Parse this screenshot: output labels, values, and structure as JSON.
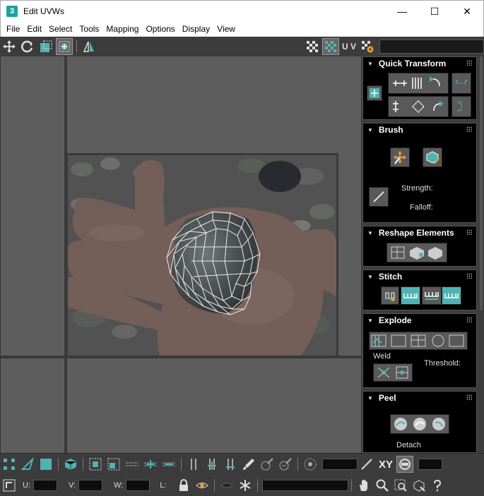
{
  "window": {
    "app_icon_text": "3",
    "title": "Edit UVWs",
    "minimize": "—",
    "maximize": "☐",
    "close": "✕"
  },
  "menu": [
    "File",
    "Edit",
    "Select",
    "Tools",
    "Mapping",
    "Options",
    "Display",
    "View"
  ],
  "top_toolbar": {
    "uv_label": "U V",
    "texture_dropdown_value": ""
  },
  "panel": {
    "quick_transform": {
      "title": "Quick Transform"
    },
    "brush": {
      "title": "Brush",
      "strength_label": "Strength:",
      "falloff_label": "Falloff:"
    },
    "reshape": {
      "title": "Reshape Elements"
    },
    "stitch": {
      "title": "Stitch"
    },
    "explode": {
      "title": "Explode",
      "weld_label": "Weld",
      "threshold_label": "Threshold:"
    },
    "peel": {
      "title": "Peel",
      "detach_label": "Detach"
    }
  },
  "bottom": {
    "xy_label": "XY",
    "u_label": "U:",
    "v_label": "V:",
    "w_label": "W:",
    "l_label": "L:",
    "u_value": "",
    "v_value": "",
    "w_value": "",
    "l_value": ""
  },
  "colors": {
    "accent": "#4fb3b3",
    "panel_bg": "#000000",
    "toolbar_bg": "#3c3c3c",
    "viewport_bg": "#5d5d5d"
  }
}
